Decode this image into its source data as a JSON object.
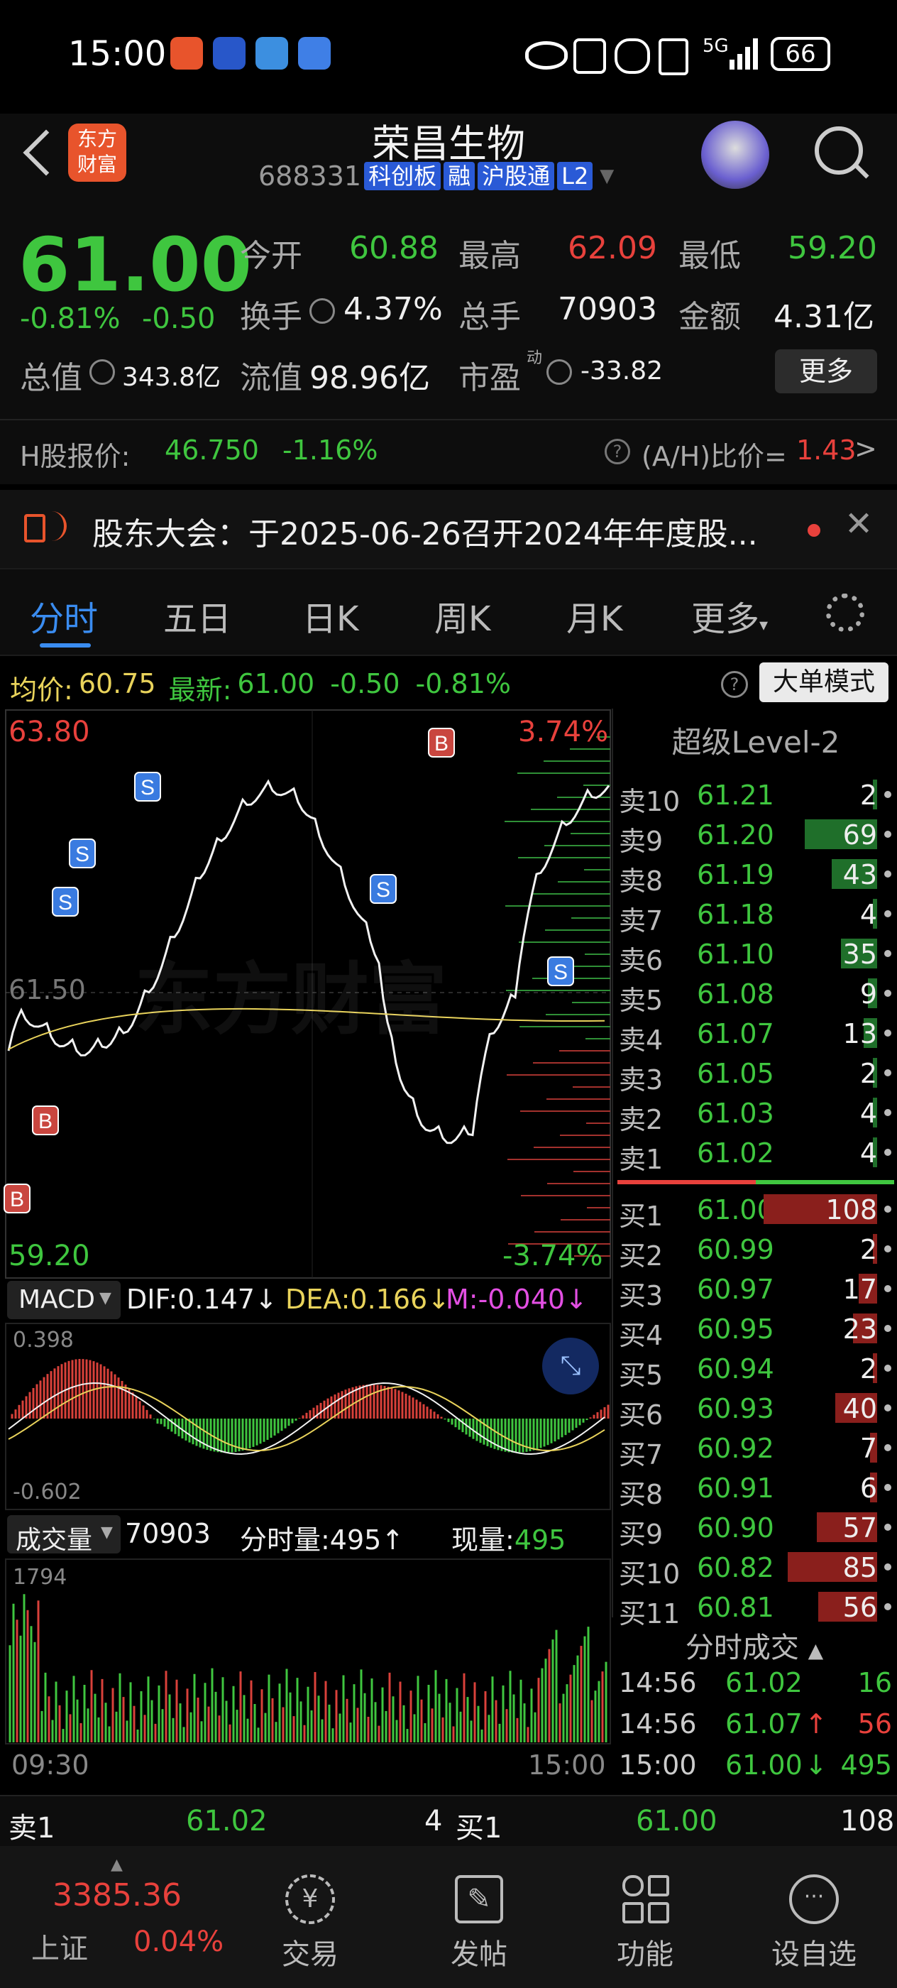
{
  "status_bar": {
    "time": "15:00",
    "battery": "66",
    "network": "5G"
  },
  "header": {
    "back_icon": "chevron-left-icon",
    "logo_text_1": "东方",
    "logo_text_2": "财富",
    "title": "荣昌生物",
    "code": "688331",
    "tags": [
      "科创板",
      "融",
      "沪股通",
      "L2"
    ]
  },
  "quote": {
    "price": "61.00",
    "change_pct": "-0.81%",
    "change": "-0.50",
    "open_label": "今开",
    "open": "60.88",
    "high_label": "最高",
    "high": "62.09",
    "low_label": "最低",
    "low": "59.20",
    "turnover_label": "换手",
    "turnover": "4.37%",
    "volume_label": "总手",
    "volume": "70903",
    "amount_label": "金额",
    "amount": "4.31亿",
    "mcap_label": "总值",
    "mcap": "343.8亿",
    "float_label": "流值",
    "float": "98.96亿",
    "pe_label": "市盈",
    "pe_sup": "动",
    "pe": "-33.82",
    "more_button": "更多"
  },
  "hk": {
    "label": "H股报价:",
    "price": "46.750",
    "change": "-1.16%",
    "ah_label": "(A/H)比价=",
    "ah_value": "1.43"
  },
  "notice": {
    "text": "股东大会：于2025-06-26召开2024年年度股..."
  },
  "tabs": [
    "分时",
    "五日",
    "日K",
    "周K",
    "月K",
    "更多"
  ],
  "avg_bar": {
    "avg_label": "均价:",
    "avg": "60.75",
    "latest_label": "最新:",
    "latest": "61.00",
    "change": "-0.50",
    "change_pct": "-0.81%",
    "mode_button": "大单模式"
  },
  "chart_labels": {
    "high_price": "63.80",
    "high_pct": "3.74%",
    "low_price": "59.20",
    "low_pct": "-3.74%",
    "mid_price": "61.50",
    "macd_selector": "MACD",
    "dif": "DIF:0.147",
    "dea": "DEA:0.166",
    "m": "M:-0.040",
    "macd_top": "0.398",
    "macd_bottom": "-0.602",
    "vol_selector": "成交量",
    "vol_total": "70903",
    "vol_tick": "分时量:495",
    "vol_now_label": "现量:",
    "vol_now": "495",
    "vol_max": "1794",
    "time_start": "09:30",
    "time_end": "15:00",
    "watermark": "东方财富"
  },
  "level2": {
    "title": "超级Level-2",
    "asks": [
      {
        "label": "卖10",
        "price": "61.21",
        "vol": "2",
        "frac": 0.02
      },
      {
        "label": "卖9",
        "price": "61.20",
        "vol": "69",
        "frac": 0.64
      },
      {
        "label": "卖8",
        "price": "61.19",
        "vol": "43",
        "frac": 0.4
      },
      {
        "label": "卖7",
        "price": "61.18",
        "vol": "4",
        "frac": 0.04
      },
      {
        "label": "卖6",
        "price": "61.10",
        "vol": "35",
        "frac": 0.32
      },
      {
        "label": "卖5",
        "price": "61.08",
        "vol": "9",
        "frac": 0.08
      },
      {
        "label": "卖4",
        "price": "61.07",
        "vol": "13",
        "frac": 0.12
      },
      {
        "label": "卖3",
        "price": "61.05",
        "vol": "2",
        "frac": 0.02
      },
      {
        "label": "卖2",
        "price": "61.03",
        "vol": "4",
        "frac": 0.04
      },
      {
        "label": "卖1",
        "price": "61.02",
        "vol": "4",
        "frac": 0.04
      }
    ],
    "bids": [
      {
        "label": "买1",
        "price": "61.00",
        "vol": "108",
        "frac": 1.0
      },
      {
        "label": "买2",
        "price": "60.99",
        "vol": "2",
        "frac": 0.02
      },
      {
        "label": "买3",
        "price": "60.97",
        "vol": "17",
        "frac": 0.16
      },
      {
        "label": "买4",
        "price": "60.95",
        "vol": "23",
        "frac": 0.21
      },
      {
        "label": "买5",
        "price": "60.94",
        "vol": "2",
        "frac": 0.02
      },
      {
        "label": "买6",
        "price": "60.93",
        "vol": "40",
        "frac": 0.37
      },
      {
        "label": "买7",
        "price": "60.92",
        "vol": "7",
        "frac": 0.06
      },
      {
        "label": "买8",
        "price": "60.91",
        "vol": "6",
        "frac": 0.06
      },
      {
        "label": "买9",
        "price": "60.90",
        "vol": "57",
        "frac": 0.53
      },
      {
        "label": "买10",
        "price": "60.82",
        "vol": "85",
        "frac": 0.79
      },
      {
        "label": "买11",
        "price": "60.81",
        "vol": "56",
        "frac": 0.52
      }
    ]
  },
  "trades": {
    "title": "分时成交",
    "rows": [
      {
        "time": "14:56",
        "price": "61.02",
        "arrow": "",
        "vol": "16",
        "dir": "green"
      },
      {
        "time": "14:56",
        "price": "61.07",
        "arrow": "↑",
        "vol": "56",
        "dir": "red"
      },
      {
        "time": "15:00",
        "price": "61.00",
        "arrow": "↓",
        "vol": "495",
        "dir": "green"
      }
    ]
  },
  "bottom_quote": {
    "ask_label": "卖1",
    "ask_price": "61.02",
    "ask_vol": "4",
    "bid_label": "买1",
    "bid_price": "61.00",
    "bid_vol": "108"
  },
  "nav": {
    "index_value": "3385.36",
    "index_name": "上证",
    "index_change": "0.04%",
    "items": [
      {
        "label": "交易",
        "icon": "trade-icon"
      },
      {
        "label": "发帖",
        "icon": "post-icon"
      },
      {
        "label": "功能",
        "icon": "apps-icon"
      },
      {
        "label": "设自选",
        "icon": "add-watchlist-icon"
      }
    ]
  },
  "colors": {
    "up": "#e8413c",
    "down": "#3fc63f",
    "accent": "#2a7be0",
    "avg_line": "#e9d35b"
  }
}
